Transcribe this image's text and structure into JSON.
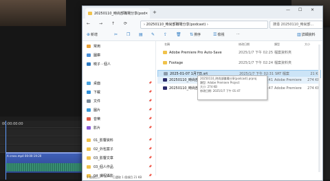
{
  "window": {
    "tab_title": "20250110_時尚部職場分享(pod",
    "close_tab": "✕",
    "new_tab": "+",
    "minimize": "—",
    "maximize": "☐",
    "close": "✕"
  },
  "nav": {
    "back": "←",
    "forward": "→",
    "up": "↑",
    "refresh": "⟳",
    "address": "› 20250110_時尚部職場分享(podcast) ›",
    "search_placeholder": "搜尋 20250110_時尚部..."
  },
  "command_bar": {
    "new": "新增",
    "sort": "排序",
    "view": "檢視",
    "more": "···",
    "details": "詳細資料"
  },
  "sidebar": {
    "items": [
      {
        "label": "常用",
        "icon": "home-icon",
        "color": "#e8a33c"
      },
      {
        "label": "圖庫",
        "icon": "gallery-icon",
        "color": "#4a90d9"
      },
      {
        "label": "曉子 - 個人",
        "icon": "onedrive-icon",
        "color": "#2b79c2"
      },
      {
        "label": "桌面",
        "icon": "desktop-icon",
        "color": "#4aa3df"
      },
      {
        "label": "下載",
        "icon": "download-icon",
        "color": "#2f8fd8"
      },
      {
        "label": "文件",
        "icon": "document-icon",
        "color": "#7a8a9a"
      },
      {
        "label": "圖片",
        "icon": "pictures-icon",
        "color": "#3a9ad9"
      },
      {
        "label": "音樂",
        "icon": "music-icon",
        "color": "#e05a47"
      },
      {
        "label": "影片",
        "icon": "video-icon",
        "color": "#8a5ad9"
      },
      {
        "label": "01_影響資料",
        "icon": "folder-icon",
        "color": "#f0c24b"
      },
      {
        "label": "02_外包案子",
        "icon": "folder-icon",
        "color": "#f0c24b"
      },
      {
        "label": "03_影響文章",
        "icon": "folder-icon",
        "color": "#f0c24b"
      },
      {
        "label": "03_個人作品",
        "icon": "folder-icon",
        "color": "#f0c24b"
      },
      {
        "label": "04_課程攝影",
        "icon": "folder-icon",
        "color": "#f0c24b"
      },
      {
        "label": "04_節目表",
        "icon": "folder-icon",
        "color": "#f0c24b"
      }
    ]
  },
  "columns": {
    "name": "名稱",
    "date": "修改日期",
    "type": "類型",
    "size": "大小"
  },
  "files": [
    {
      "name": "Adobe Premiere Pro Auto-Save",
      "date": "2025/1/7 下午 02:25",
      "type": "檔案資料夾",
      "size": "",
      "color": "#f0c24b",
      "state": ""
    },
    {
      "name": "Footage",
      "date": "2025/1/7 下午 02:24",
      "type": "檔案資料夾",
      "size": "",
      "color": "#f0c24b",
      "state": ""
    },
    {
      "name": "2025-01-07 1月7日.srt",
      "date": "2025/1/7 下午 02:31",
      "type": "SRT 檔案",
      "size": "21 KB",
      "color": "#8a9aaa",
      "state": "sel"
    },
    {
      "name": "20250110_時尚部職場分享(podcast).pr...",
      "date": "2025/1/7 下午 01:41",
      "type": "Adobe Premiere",
      "size": "274 KB",
      "color": "#2a2a6a",
      "state": "hov"
    },
    {
      "name": "20250110_時尚部職場分享(podcast).prproj",
      "date": "2025/1/7 下午 01:47",
      "type": "Adobe Premiere",
      "size": "274 KB",
      "color": "#2a2a6a",
      "state": ""
    }
  ],
  "tooltip": {
    "line1": "20250110_時尚部職場分享(podcast).prproj",
    "line2": "類型: Adobe Premiere Project",
    "line3": "大小: 274 KB",
    "line4": "修改日期: 2025/1/7 下午 01:47"
  },
  "status": {
    "count": "5 個項目",
    "selected": "已選取 1 個項目 21 KB"
  },
  "editor": {
    "timecode": "00:00:00:00",
    "clip_label": "A cross.mp4  00:00:19:20"
  }
}
